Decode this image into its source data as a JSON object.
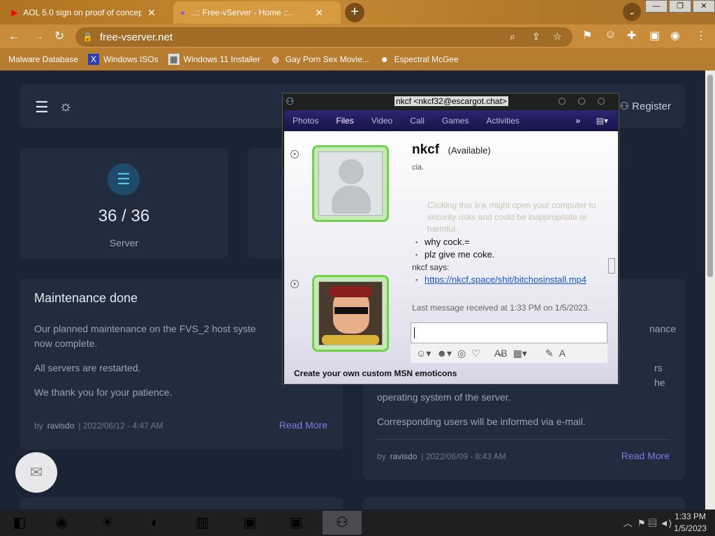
{
  "browser": {
    "tabs": [
      {
        "title": "AOL 5.0 sign on proof of concept",
        "close": "✕"
      },
      {
        "title": "..:: Free-vServer - Home ::..",
        "close": "✕"
      }
    ],
    "new_tab": "+",
    "address": "free-vserver.net",
    "bookmarks": [
      "Malware Database",
      "Windows ISOs",
      "Windows 11 Installer",
      "Gay Porn Sex Movie...",
      "Espectral McGee"
    ]
  },
  "site": {
    "register": "Register",
    "stat": {
      "value": "36 / 36",
      "label": "Server"
    },
    "post1": {
      "title": "Maintenance done",
      "p1": "Our planned maintenance on the FVS_2 host system is now complete.",
      "p1_visible": "Our planned maintenance on the FVS_2 host syste",
      "p1b": "now complete.",
      "p2": "All servers are restarted.",
      "p3": "We thank you for your patience.",
      "by": "by",
      "author": "ravisdo",
      "date": "| 2022/06/12 - 4:47 AM",
      "read_more": "Read More"
    },
    "post2": {
      "frag1": "nance",
      "frag2": "rs",
      "frag3": "he",
      "p3": "operating system of the server.",
      "p4": "Corresponding users will be informed via e-mail.",
      "by": "by",
      "author": "ravisdo",
      "date": "| 2022/06/09 - 8:43 AM",
      "read_more": "Read More"
    }
  },
  "msn": {
    "title": "nkcf <nkcf32@escargot.chat>",
    "menu": [
      "Photos",
      "Files",
      "Video",
      "Call",
      "Games",
      "Activities"
    ],
    "contact_name": "nkcf",
    "contact_status": "(Available)",
    "personal_message": "cia.",
    "warning": "Clicking this link might open your computer to security risks and could be inappropriate or harmful.",
    "messages": [
      "why cock.=",
      "plz give me coke."
    ],
    "says": "nkcf says:",
    "link": "https://nkcf.space/shit/bitchosinstall.mp4",
    "last_message": "Last message received at 1:33 PM on 1/5/2023.",
    "footer": "Create your own custom MSN emoticons"
  },
  "taskbar": {
    "time": "1:33 PM",
    "date": "1/5/2023"
  }
}
